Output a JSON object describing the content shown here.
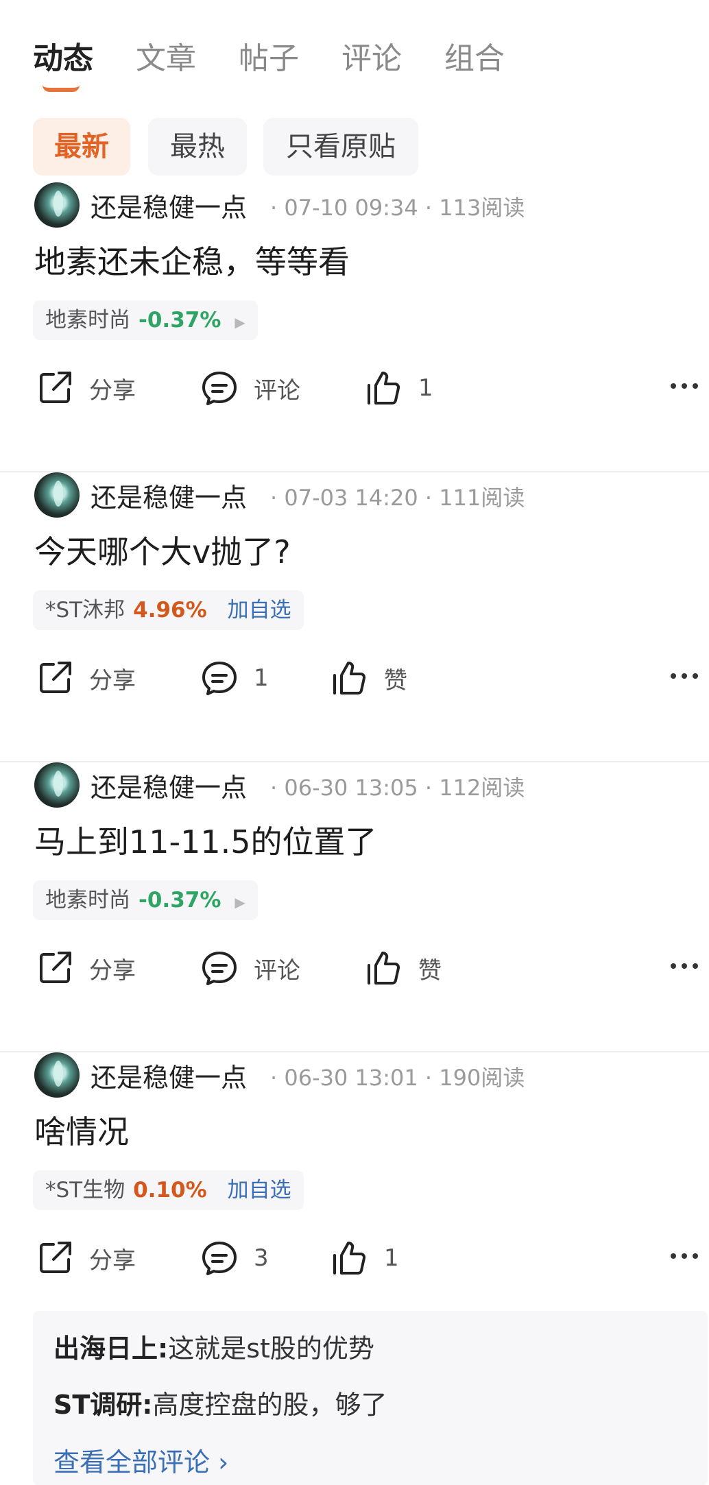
{
  "tabs": [
    {
      "label": "动态"
    },
    {
      "label": "文章"
    },
    {
      "label": "帖子"
    },
    {
      "label": "评论"
    },
    {
      "label": "组合"
    }
  ],
  "filters": [
    {
      "label": "最新"
    },
    {
      "label": "最热"
    },
    {
      "label": "只看原贴"
    }
  ],
  "posts": [
    {
      "author": "还是稳健一点",
      "meta": "· 07-10 09:34 · 113阅读",
      "text": "地素还未企稳，等等看",
      "stock": {
        "name": "地素时尚",
        "change": "-0.37%",
        "arrow": "▶",
        "add": ""
      },
      "share": "分享",
      "comment": "评论",
      "like": "1"
    },
    {
      "author": "还是稳健一点",
      "meta": "· 07-03 14:20 · 111阅读",
      "text": "今天哪个大v抛了?",
      "stock": {
        "name": "*ST沐邦",
        "change": "4.96%",
        "arrow": "",
        "add": "加自选"
      },
      "share": "分享",
      "comment": "1",
      "like": "赞"
    },
    {
      "author": "还是稳健一点",
      "meta": "· 06-30 13:05 · 112阅读",
      "text": "马上到11-11.5的位置了",
      "stock": {
        "name": "地素时尚",
        "change": "-0.37%",
        "arrow": "▶",
        "add": ""
      },
      "share": "分享",
      "comment": "评论",
      "like": "赞"
    },
    {
      "author": "还是稳健一点",
      "meta": "· 06-30 13:01 · 190阅读",
      "text": "啥情况",
      "stock": {
        "name": "*ST生物",
        "change": "0.10%",
        "arrow": "",
        "add": "加自选"
      },
      "share": "分享",
      "comment": "3",
      "like": "1"
    }
  ],
  "comments": [
    {
      "who": "出海日上:",
      "text": "这就是st股的优势"
    },
    {
      "who": "ST调研:",
      "text": "高度控盘的股，够了"
    }
  ],
  "view_all": "查看全部评论 ›",
  "colors": {
    "accent": "#e8733a",
    "down": "#2fa565",
    "up": "#d4581c",
    "link": "#3a6fb5"
  }
}
